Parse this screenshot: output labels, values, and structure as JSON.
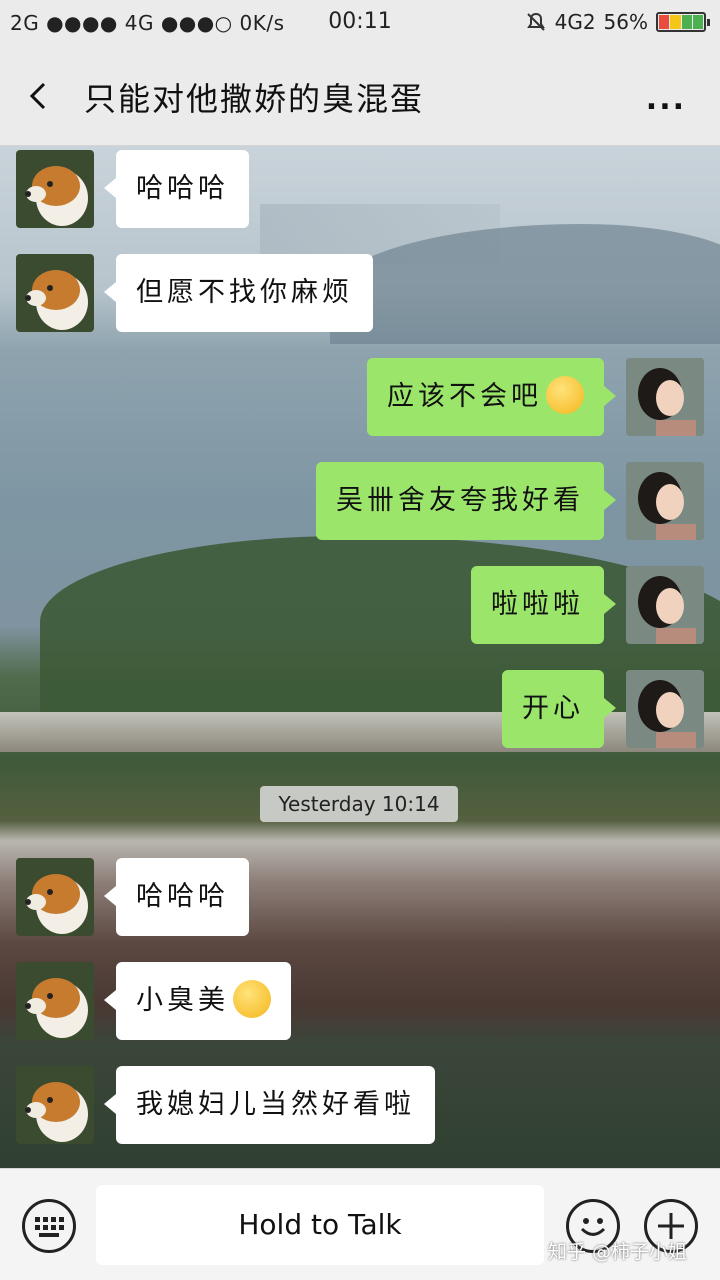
{
  "status_bar": {
    "network": "2G ●●●● 4G ●●●○ 0K/s",
    "time": "00:11",
    "signal": "4G2",
    "battery": "56%"
  },
  "header": {
    "title": "只能对他撒娇的臭混蛋",
    "more_label": "..."
  },
  "messages": [
    {
      "side": "in",
      "text": "哈哈哈"
    },
    {
      "side": "in",
      "text": "但愿不找你麻烦"
    },
    {
      "side": "out",
      "text": "应该不会吧",
      "emoji": "blush-emoji"
    },
    {
      "side": "out",
      "text": "吴卌舍友夸我好看"
    },
    {
      "side": "out",
      "text": "啦啦啦"
    },
    {
      "side": "out",
      "text": "开心"
    },
    {
      "side": "in",
      "text": "哈哈哈"
    },
    {
      "side": "in",
      "text": "小臭美",
      "emoji": "smirk-emoji"
    },
    {
      "side": "in",
      "text": "我媳妇儿当然好看啦"
    }
  ],
  "timestamp": "Yesterday 10:14",
  "bottom_bar": {
    "hold_to_talk": "Hold to Talk",
    "watermark": "知乎 @柿子小姐"
  },
  "colors": {
    "outgoing_bubble": "#9be66a",
    "incoming_bubble": "#ffffff",
    "battery": [
      "#e94b3c",
      "#f5c518",
      "#4caf50",
      "#4caf50"
    ]
  }
}
